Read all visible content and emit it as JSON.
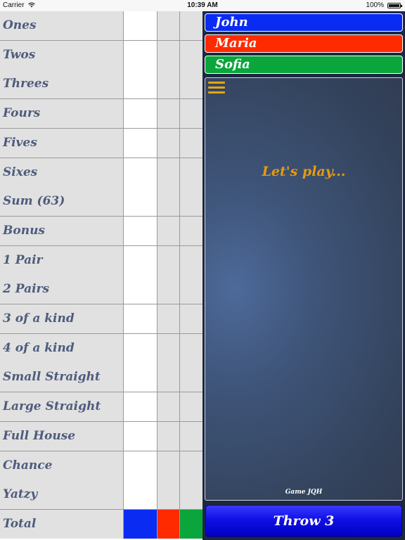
{
  "status_bar": {
    "carrier": "Carrier",
    "time": "10:39 AM",
    "battery": "100%"
  },
  "scorecard": {
    "rows": [
      {
        "label": "Ones"
      },
      {
        "label": "Twos"
      },
      {
        "label": "Threes"
      },
      {
        "label": "Fours"
      },
      {
        "label": "Fives"
      },
      {
        "label": "Sixes"
      },
      {
        "label": "Sum (63)"
      },
      {
        "label": "Bonus"
      },
      {
        "label": "1 Pair"
      },
      {
        "label": "2 Pairs"
      },
      {
        "label": "3 of a kind"
      },
      {
        "label": "4 of a kind"
      },
      {
        "label": "Small Straight"
      },
      {
        "label": "Large Straight"
      },
      {
        "label": "Full House"
      },
      {
        "label": "Chance"
      },
      {
        "label": "Yatzy"
      },
      {
        "label": "Total"
      }
    ],
    "player_colors": [
      "#0a2cf2",
      "#ff2a00",
      "#0aa63c"
    ]
  },
  "players": [
    {
      "name": "John",
      "color": "#0a2cf2"
    },
    {
      "name": "Maria",
      "color": "#ff2a00"
    },
    {
      "name": "Sofia",
      "color": "#0aa63c"
    }
  ],
  "board": {
    "message": "Let's play...",
    "game_label": "Game JQH",
    "menu_icon": "hamburger-menu-icon"
  },
  "throw_button": {
    "label": "Throw 3"
  }
}
